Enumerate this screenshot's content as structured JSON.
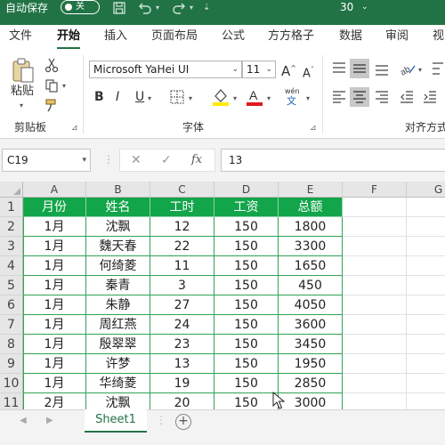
{
  "titlebar": {
    "autosave": "自动保存",
    "toggle": "关",
    "filename": "30"
  },
  "tabs": [
    "文件",
    "开始",
    "插入",
    "页面布局",
    "公式",
    "方方格子",
    "数据",
    "审阅",
    "视"
  ],
  "ribbon": {
    "paste": "粘贴",
    "font_name": "Microsoft YaHei UI",
    "font_size": "11",
    "bold": "B",
    "italic": "I",
    "underline": "U",
    "wen": "wén",
    "wen_char": "文",
    "groups": {
      "clipboard": "剪贴板",
      "font": "字体",
      "align": "对齐方式"
    }
  },
  "formula_bar": {
    "name_box": "C19",
    "fx": "fx",
    "formula": "13"
  },
  "columns": [
    "A",
    "B",
    "C",
    "D",
    "E",
    "F",
    "G"
  ],
  "rows": [
    "1",
    "2",
    "3",
    "4",
    "5",
    "6",
    "7",
    "8",
    "9",
    "10",
    "11"
  ],
  "table": {
    "headers": [
      "月份",
      "姓名",
      "工时",
      "工资",
      "总额"
    ],
    "data": [
      [
        "1月",
        "沈飘",
        "12",
        "150",
        "1800"
      ],
      [
        "1月",
        "魏天春",
        "22",
        "150",
        "3300"
      ],
      [
        "1月",
        "何绮菱",
        "11",
        "150",
        "1650"
      ],
      [
        "1月",
        "秦青",
        "3",
        "150",
        "450"
      ],
      [
        "1月",
        "朱静",
        "27",
        "150",
        "4050"
      ],
      [
        "1月",
        "周红燕",
        "24",
        "150",
        "3600"
      ],
      [
        "1月",
        "殷翠翠",
        "23",
        "150",
        "3450"
      ],
      [
        "1月",
        "许梦",
        "13",
        "150",
        "1950"
      ],
      [
        "1月",
        "华绮菱",
        "19",
        "150",
        "2850"
      ],
      [
        "2月",
        "沈飘",
        "20",
        "150",
        "3000"
      ]
    ]
  },
  "sheet_tabs": [
    "Sheet1"
  ],
  "colors": {
    "brand": "#217346",
    "table_header": "#12a54a",
    "table_border": "#31a354"
  }
}
